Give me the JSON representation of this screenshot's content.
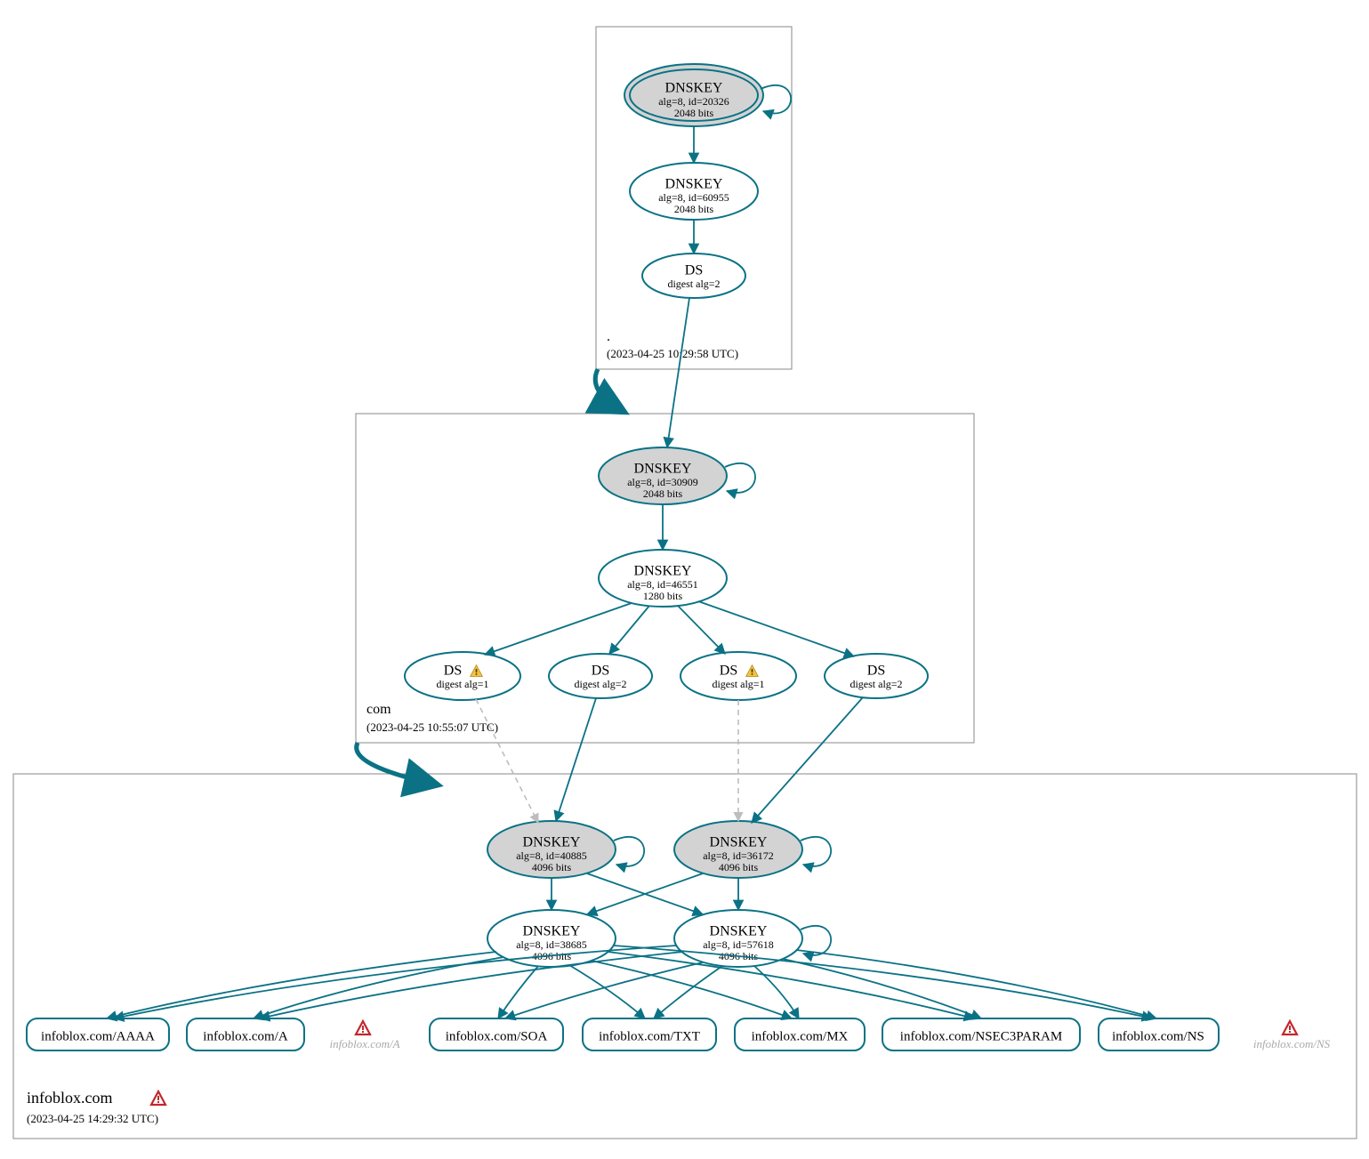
{
  "colors": {
    "accent": "#0b7285",
    "node_grey": "#d3d3d3",
    "warn_yellow": "#f6c343",
    "error_red": "#c1272d"
  },
  "zones": {
    "root": {
      "label": ".",
      "timestamp": "(2023-04-25 10:29:58 UTC)"
    },
    "com": {
      "label": "com",
      "timestamp": "(2023-04-25 10:55:07 UTC)"
    },
    "infoblox": {
      "label": "infoblox.com",
      "timestamp": "(2023-04-25 14:29:32 UTC)"
    }
  },
  "nodes": {
    "root_ksk": {
      "t": "DNSKEY",
      "l1": "alg=8, id=20326",
      "l2": "2048 bits"
    },
    "root_zsk": {
      "t": "DNSKEY",
      "l1": "alg=8, id=60955",
      "l2": "2048 bits"
    },
    "root_ds": {
      "t": "DS",
      "l1": "digest alg=2",
      "l2": ""
    },
    "com_ksk": {
      "t": "DNSKEY",
      "l1": "alg=8, id=30909",
      "l2": "2048 bits"
    },
    "com_zsk": {
      "t": "DNSKEY",
      "l1": "alg=8, id=46551",
      "l2": "1280 bits"
    },
    "com_ds1": {
      "t": "DS",
      "l1": "digest alg=1",
      "l2": ""
    },
    "com_ds2": {
      "t": "DS",
      "l1": "digest alg=2",
      "l2": ""
    },
    "com_ds3": {
      "t": "DS",
      "l1": "digest alg=1",
      "l2": ""
    },
    "com_ds4": {
      "t": "DS",
      "l1": "digest alg=2",
      "l2": ""
    },
    "ib_ksk1": {
      "t": "DNSKEY",
      "l1": "alg=8, id=40885",
      "l2": "4096 bits"
    },
    "ib_ksk2": {
      "t": "DNSKEY",
      "l1": "alg=8, id=36172",
      "l2": "4096 bits"
    },
    "ib_zsk1": {
      "t": "DNSKEY",
      "l1": "alg=8, id=38685",
      "l2": "4096 bits"
    },
    "ib_zsk2": {
      "t": "DNSKEY",
      "l1": "alg=8, id=57618",
      "l2": "4096 bits"
    }
  },
  "rrsets": {
    "aaaa": "infoblox.com/AAAA",
    "a": "infoblox.com/A",
    "soa": "infoblox.com/SOA",
    "txt": "infoblox.com/TXT",
    "mx": "infoblox.com/MX",
    "nsec3": "infoblox.com/NSEC3PARAM",
    "ns": "infoblox.com/NS"
  },
  "insecure": {
    "a": "infoblox.com/A",
    "ns": "infoblox.com/NS"
  }
}
